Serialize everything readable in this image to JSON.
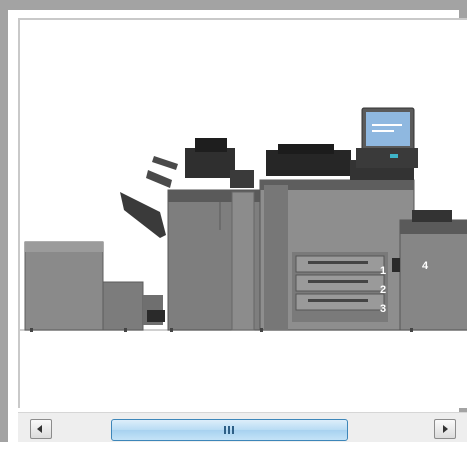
{
  "window": {
    "frame_color": "#a3a3a3",
    "background": "#ffffff"
  },
  "illustration": {
    "subject": "production-printer-system",
    "callouts": [
      {
        "id": "tray-1",
        "label": "1"
      },
      {
        "id": "tray-2",
        "label": "2"
      },
      {
        "id": "tray-3",
        "label": "3"
      },
      {
        "id": "large-capacity-unit",
        "label": "4"
      }
    ]
  },
  "scrollbar": {
    "orientation": "horizontal",
    "left_arrow_icon": "chevron-left-icon",
    "right_arrow_icon": "chevron-right-icon",
    "thumb_grip_icon": "grip-icon",
    "position_fraction": 0.25,
    "thumb_color": "#b8dcf4"
  }
}
